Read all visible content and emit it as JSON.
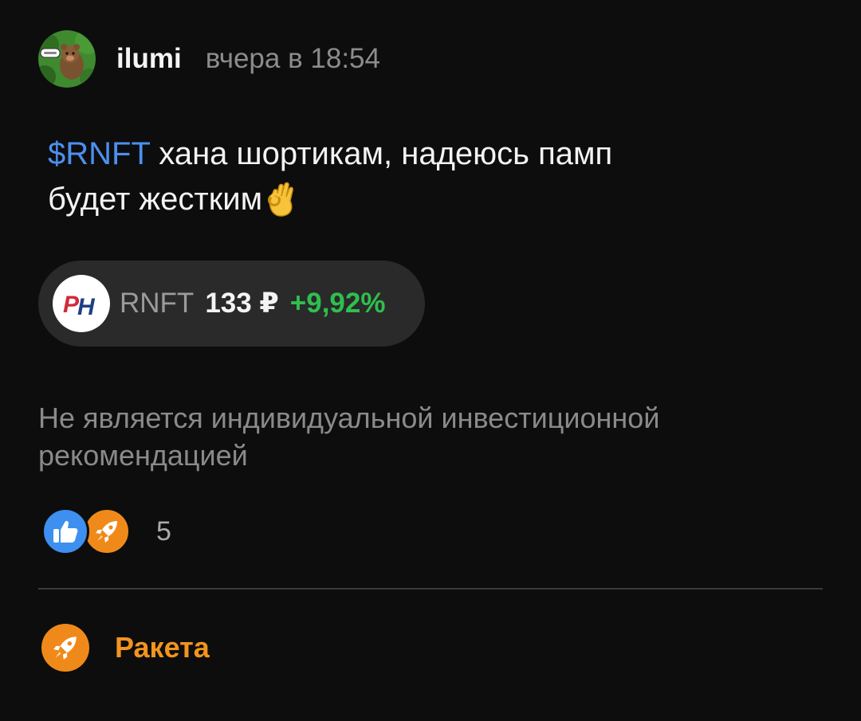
{
  "post": {
    "author": "ilumi",
    "timestamp": "вчера в 18:54",
    "avatar_icon": "bear-avatar-icon",
    "text": {
      "ticker": "$RNFT",
      "line1_rest": " хана шортикам, надеюсь памп",
      "line2": "будет жестким",
      "emoji": "ok-hand-emoji"
    }
  },
  "ticker_chip": {
    "logo_icon": "rn-logo-icon",
    "logo_text": "PH",
    "ticker": "RNFT",
    "price": "133 ₽",
    "change": "+9,92%",
    "change_color": "#2fbf4f"
  },
  "disclaimer": "Не является индивидуальной инвестиционной рекомендацией",
  "reactions": {
    "icons": [
      "thumbs-up-icon",
      "rocket-icon"
    ],
    "count": "5"
  },
  "rocket_action": {
    "icon": "rocket-icon",
    "label": "Ракета"
  },
  "colors": {
    "background": "#0d0d0d",
    "link": "#4d8ff0",
    "positive": "#2fbf4f",
    "accent_orange": "#f2941e",
    "like_blue": "#3d8ff0"
  }
}
